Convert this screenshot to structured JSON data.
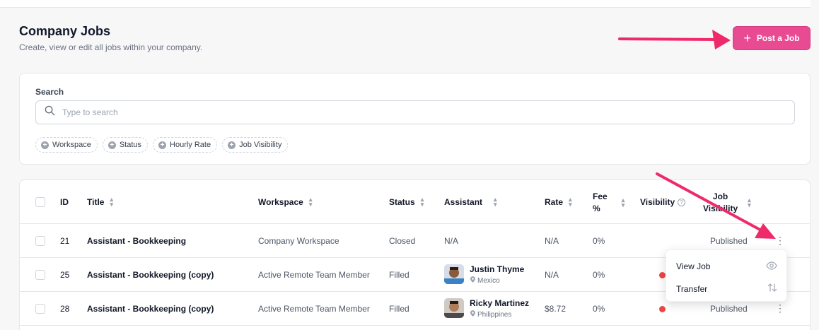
{
  "header": {
    "title": "Company Jobs",
    "subtitle": "Create, view or edit all jobs within your company.",
    "post_button_label": "Post a Job"
  },
  "search": {
    "label": "Search",
    "placeholder": "Type to search",
    "filters": [
      "Workspace",
      "Status",
      "Hourly Rate",
      "Job Visibility"
    ]
  },
  "table": {
    "columns": {
      "id": "ID",
      "title": "Title",
      "workspace": "Workspace",
      "status": "Status",
      "assistant": "Assistant",
      "rate": "Rate",
      "fee_line1": "Fee",
      "fee_line2": "%",
      "visibility": "Visibility",
      "job_visibility_line1": "Job",
      "job_visibility_line2": "Visibility"
    },
    "rows": [
      {
        "id": "21",
        "title": "Assistant - Bookkeeping",
        "workspace": "Company Workspace",
        "status": "Closed",
        "assistant": "N/A",
        "location": "",
        "rate": "N/A",
        "fee": "0%",
        "job_visibility": "Published"
      },
      {
        "id": "25",
        "title": "Assistant - Bookkeeping (copy)",
        "workspace": "Active Remote Team Member",
        "status": "Filled",
        "assistant": "Justin Thyme",
        "location": "Mexico",
        "rate": "N/A",
        "fee": "0%",
        "job_visibility": ""
      },
      {
        "id": "28",
        "title": "Assistant - Bookkeeping (copy)",
        "workspace": "Active Remote Team Member",
        "status": "Filled",
        "assistant": "Ricky Martinez",
        "location": "Philippines",
        "rate": "$8.72",
        "fee": "0%",
        "job_visibility": "Published"
      }
    ]
  },
  "menu": {
    "items": [
      {
        "label": "View Job",
        "icon": "eye-icon"
      },
      {
        "label": "Transfer",
        "icon": "swap-vertical-icon"
      }
    ]
  },
  "colors": {
    "accent": "#e94b93",
    "annotation_arrow": "#ef2a6b",
    "visibility_dot": "#ef4444"
  }
}
